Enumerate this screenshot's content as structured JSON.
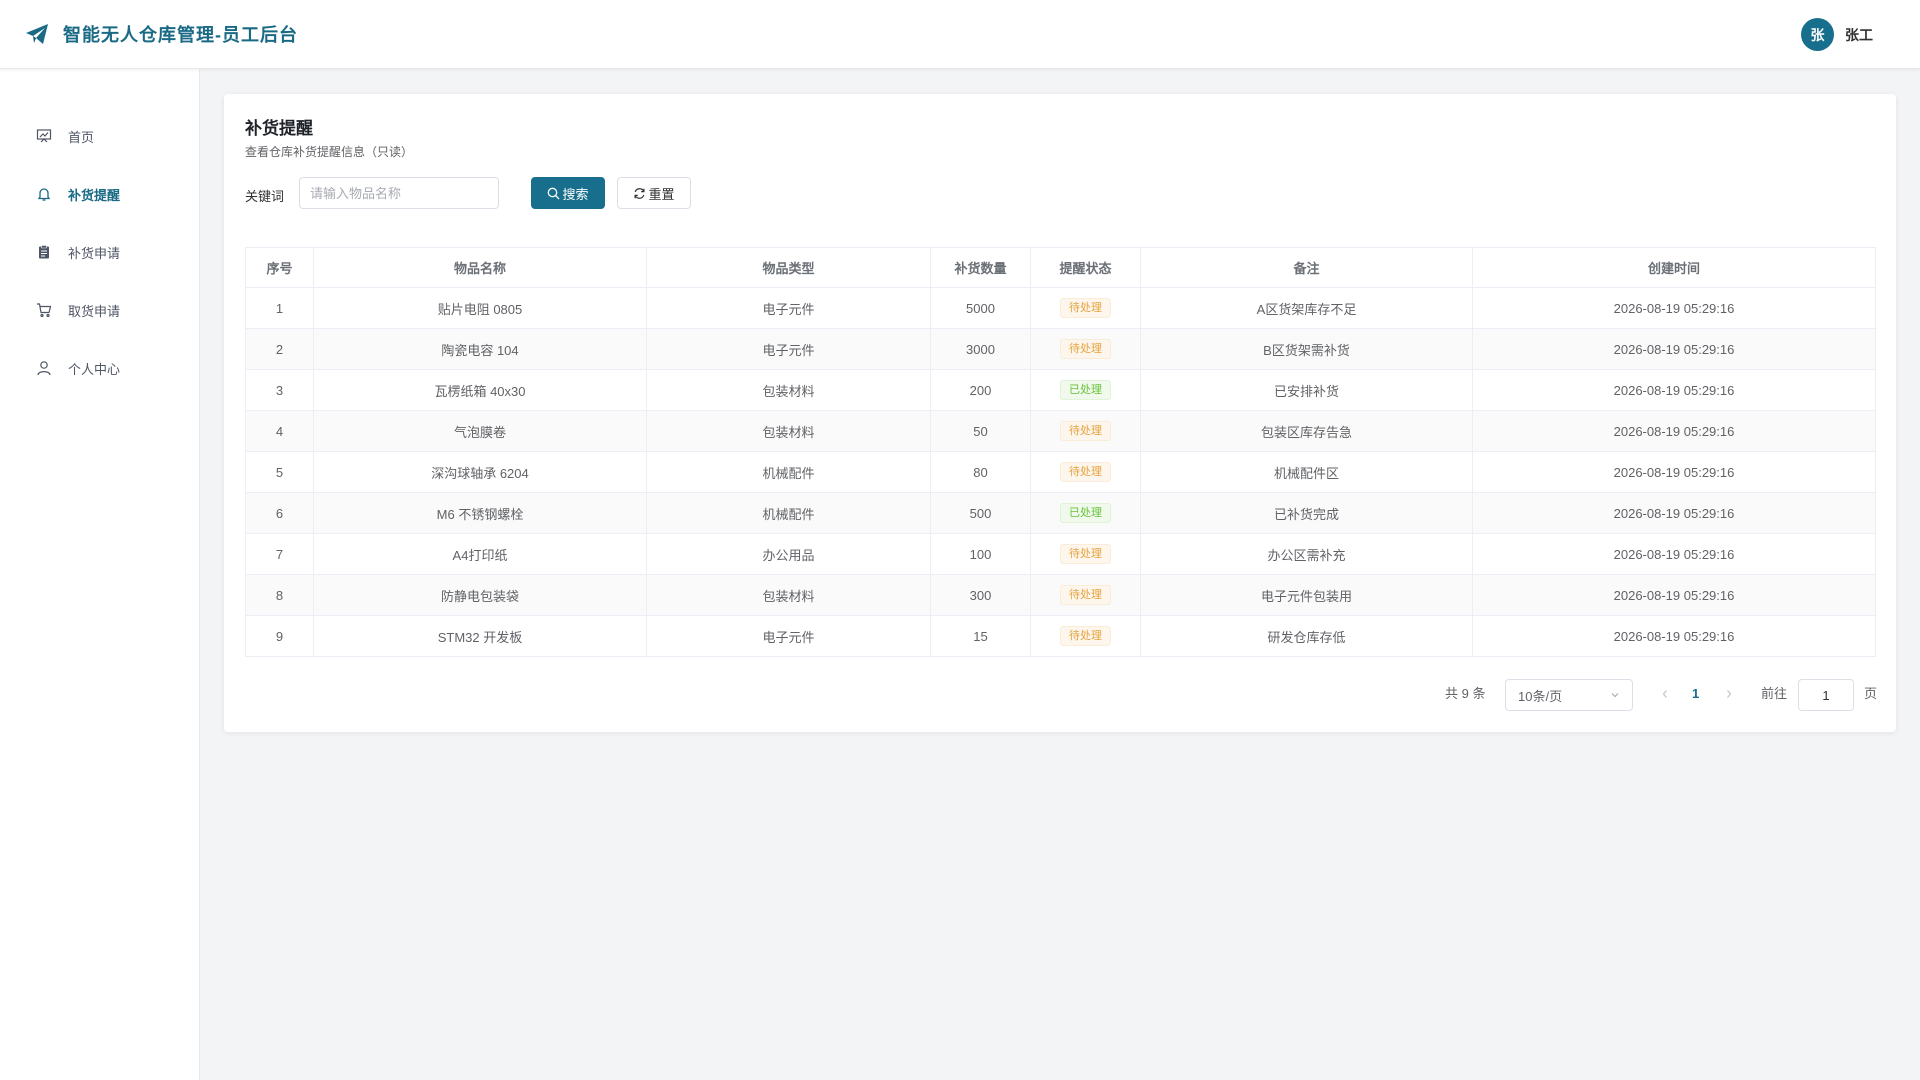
{
  "header": {
    "title": "智能无人仓库管理-员工后台",
    "avatar_text": "张",
    "user_name": "张工",
    "accent": "#176f8d"
  },
  "sidebar": {
    "items": [
      {
        "label": "首页",
        "icon": "presentation-chart-icon",
        "active": false
      },
      {
        "label": "补货提醒",
        "icon": "bell-icon",
        "active": true
      },
      {
        "label": "补货申请",
        "icon": "clipboard-icon",
        "active": false
      },
      {
        "label": "取货申请",
        "icon": "cart-icon",
        "active": false
      },
      {
        "label": "个人中心",
        "icon": "user-icon",
        "active": false
      }
    ]
  },
  "main": {
    "title": "补货提醒",
    "subtitle": "查看仓库补货提醒信息（只读）",
    "search": {
      "label": "关键词",
      "placeholder": "请输入物品名称",
      "value": "",
      "search_button": "搜索",
      "reset_button": "重置"
    },
    "table": {
      "columns": [
        "序号",
        "物品名称",
        "物品类型",
        "补货数量",
        "提醒状态",
        "备注",
        "创建时间"
      ],
      "rows": [
        {
          "no": "1",
          "name": "贴片电阻 0805",
          "type": "电子元件",
          "qty": "5000",
          "status": "待处理",
          "status_kind": "pending",
          "note": "A区货架库存不足",
          "time": "2026-08-19 05:29:16"
        },
        {
          "no": "2",
          "name": "陶瓷电容 104",
          "type": "电子元件",
          "qty": "3000",
          "status": "待处理",
          "status_kind": "pending",
          "note": "B区货架需补货",
          "time": "2026-08-19 05:29:16"
        },
        {
          "no": "3",
          "name": "瓦楞纸箱 40x30",
          "type": "包装材料",
          "qty": "200",
          "status": "已处理",
          "status_kind": "done",
          "note": "已安排补货",
          "time": "2026-08-19 05:29:16"
        },
        {
          "no": "4",
          "name": "气泡膜卷",
          "type": "包装材料",
          "qty": "50",
          "status": "待处理",
          "status_kind": "pending",
          "note": "包装区库存告急",
          "time": "2026-08-19 05:29:16"
        },
        {
          "no": "5",
          "name": "深沟球轴承 6204",
          "type": "机械配件",
          "qty": "80",
          "status": "待处理",
          "status_kind": "pending",
          "note": "机械配件区",
          "time": "2026-08-19 05:29:16"
        },
        {
          "no": "6",
          "name": "M6 不锈钢螺栓",
          "type": "机械配件",
          "qty": "500",
          "status": "已处理",
          "status_kind": "done",
          "note": "已补货完成",
          "time": "2026-08-19 05:29:16"
        },
        {
          "no": "7",
          "name": "A4打印纸",
          "type": "办公用品",
          "qty": "100",
          "status": "待处理",
          "status_kind": "pending",
          "note": "办公区需补充",
          "time": "2026-08-19 05:29:16"
        },
        {
          "no": "8",
          "name": "防静电包装袋",
          "type": "包装材料",
          "qty": "300",
          "status": "待处理",
          "status_kind": "pending",
          "note": "电子元件包装用",
          "time": "2026-08-19 05:29:16"
        },
        {
          "no": "9",
          "name": "STM32 开发板",
          "type": "电子元件",
          "qty": "15",
          "status": "待处理",
          "status_kind": "pending",
          "note": "研发仓库存低",
          "time": "2026-08-19 05:29:16"
        }
      ]
    },
    "pagination": {
      "total_text": "共 9 条",
      "page_size": "10条/页",
      "current_page": "1",
      "goto_label": "前往",
      "goto_value": "1",
      "page_suffix": "页"
    }
  }
}
